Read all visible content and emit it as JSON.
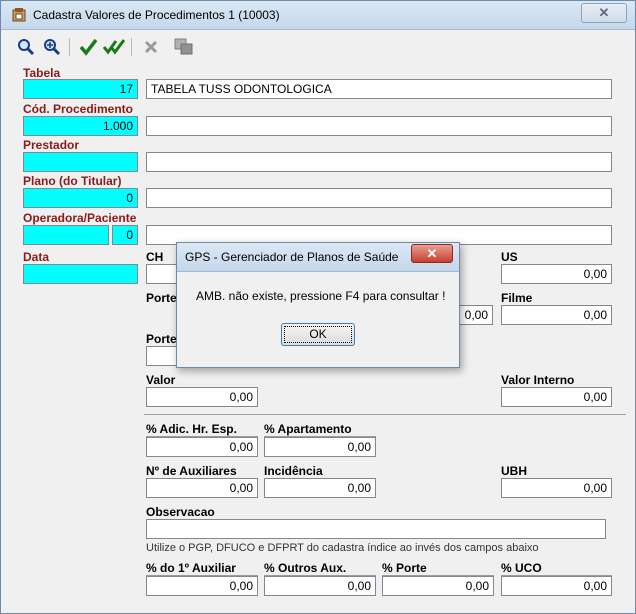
{
  "window": {
    "title": "Cadastra Valores de Procedimentos 1 (10003)",
    "close_glyph": "✕"
  },
  "toolbar": {
    "icons": [
      "search-icon",
      "search-next-icon",
      "check-icon",
      "check-all-icon",
      "delete-icon",
      "copy-icon"
    ]
  },
  "form": {
    "tabela": {
      "label": "Tabela",
      "code": "17",
      "desc": "TABELA TUSS ODONTOLOGICA"
    },
    "cod_procedimento": {
      "label": "Cód. Procedimento",
      "code": "1.000",
      "desc": ""
    },
    "prestador": {
      "label": "Prestador",
      "code": "",
      "desc": ""
    },
    "plano": {
      "label": "Plano (do Titular)",
      "code": "0",
      "desc": ""
    },
    "operadora": {
      "label": "Operadora/Paciente",
      "code": "",
      "code2": "0",
      "desc": ""
    },
    "data": {
      "label": "Data",
      "value": ""
    },
    "ch": {
      "label": "CH",
      "value": ""
    },
    "us": {
      "label": "US",
      "value": "0,00"
    },
    "porte1": {
      "label": "Porte",
      "value": "0,00"
    },
    "filme": {
      "label": "Filme",
      "value": "0,00"
    },
    "porte2": {
      "label": "Porte",
      "value": ""
    },
    "valor": {
      "label": "Valor",
      "value": "0,00"
    },
    "valor_interno": {
      "label": "Valor Interno",
      "value": "0,00"
    },
    "adic_hr": {
      "label": "% Adic. Hr. Esp.",
      "value": "0,00"
    },
    "apartamento": {
      "label": "% Apartamento",
      "value": "0,00"
    },
    "auxiliares": {
      "label": "Nº de Auxiliares",
      "value": "0,00"
    },
    "incidencia": {
      "label": "Incidência",
      "value": "0,00"
    },
    "ubh": {
      "label": "UBH",
      "value": "0,00"
    },
    "observacao": {
      "label": "Observacao",
      "value": ""
    },
    "note": "Utilize o PGP, DFUCO e DFPRT do cadastra índice ao invés dos campos abaixo",
    "primeiro_aux": {
      "label": "% do 1º Auxiliar",
      "value": "0,00"
    },
    "outros_aux": {
      "label": "% Outros Aux.",
      "value": "0,00"
    },
    "porte_pct": {
      "label": "% Porte",
      "value": "0,00"
    },
    "uco": {
      "label": "% UCO",
      "value": "0,00"
    }
  },
  "dialog": {
    "title": "GPS - Gerenciador de Planos de Saúde",
    "message": "AMB. não existe, pressione F4 para consultar !",
    "ok_label": "OK",
    "close_glyph": "✕"
  }
}
